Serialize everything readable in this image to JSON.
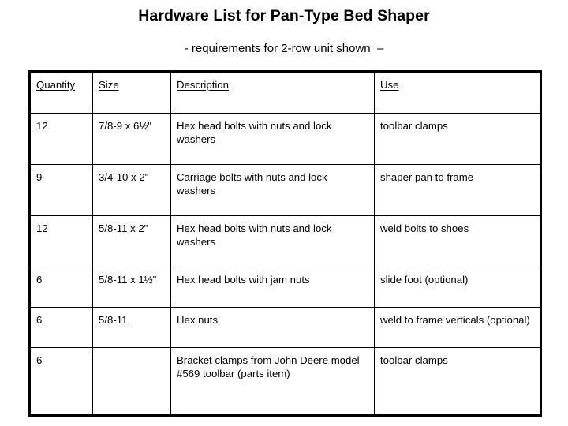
{
  "slide": {
    "title": "Hardware List for Pan-Type Bed Shaper",
    "subtitle": "- requirements for 2-row unit shown  –"
  },
  "table": {
    "headers": {
      "quantity": "Quantity",
      "size": "Size",
      "description": "Description",
      "use": "Use"
    },
    "rows": [
      {
        "quantity": "12",
        "size": "7/8-9 x 6½\"",
        "description": "Hex head bolts with nuts and lock washers",
        "use": "toolbar clamps"
      },
      {
        "quantity": "9",
        "size": "3/4-10 x 2\"",
        "description": "Carriage bolts with nuts and lock washers",
        "use": "shaper pan to frame"
      },
      {
        "quantity": "12",
        "size": "5/8-11 x 2\"",
        "description": "Hex head bolts with nuts and lock washers",
        "use": "weld bolts to shoes"
      },
      {
        "quantity": "6",
        "size": "5/8-11 x 1½\"",
        "description": "Hex head bolts with jam nuts",
        "use": "slide foot (optional)"
      },
      {
        "quantity": "6",
        "size": "5/8-11",
        "description": "Hex nuts",
        "use": "weld to frame verticals (optional)"
      },
      {
        "quantity": "6",
        "size": "",
        "description": "Bracket clamps from John Deere model #569 toolbar (parts item)",
        "use": "toolbar clamps"
      }
    ]
  },
  "colors": {
    "background": "#ffffff",
    "text": "#000000",
    "border": "#000000"
  }
}
